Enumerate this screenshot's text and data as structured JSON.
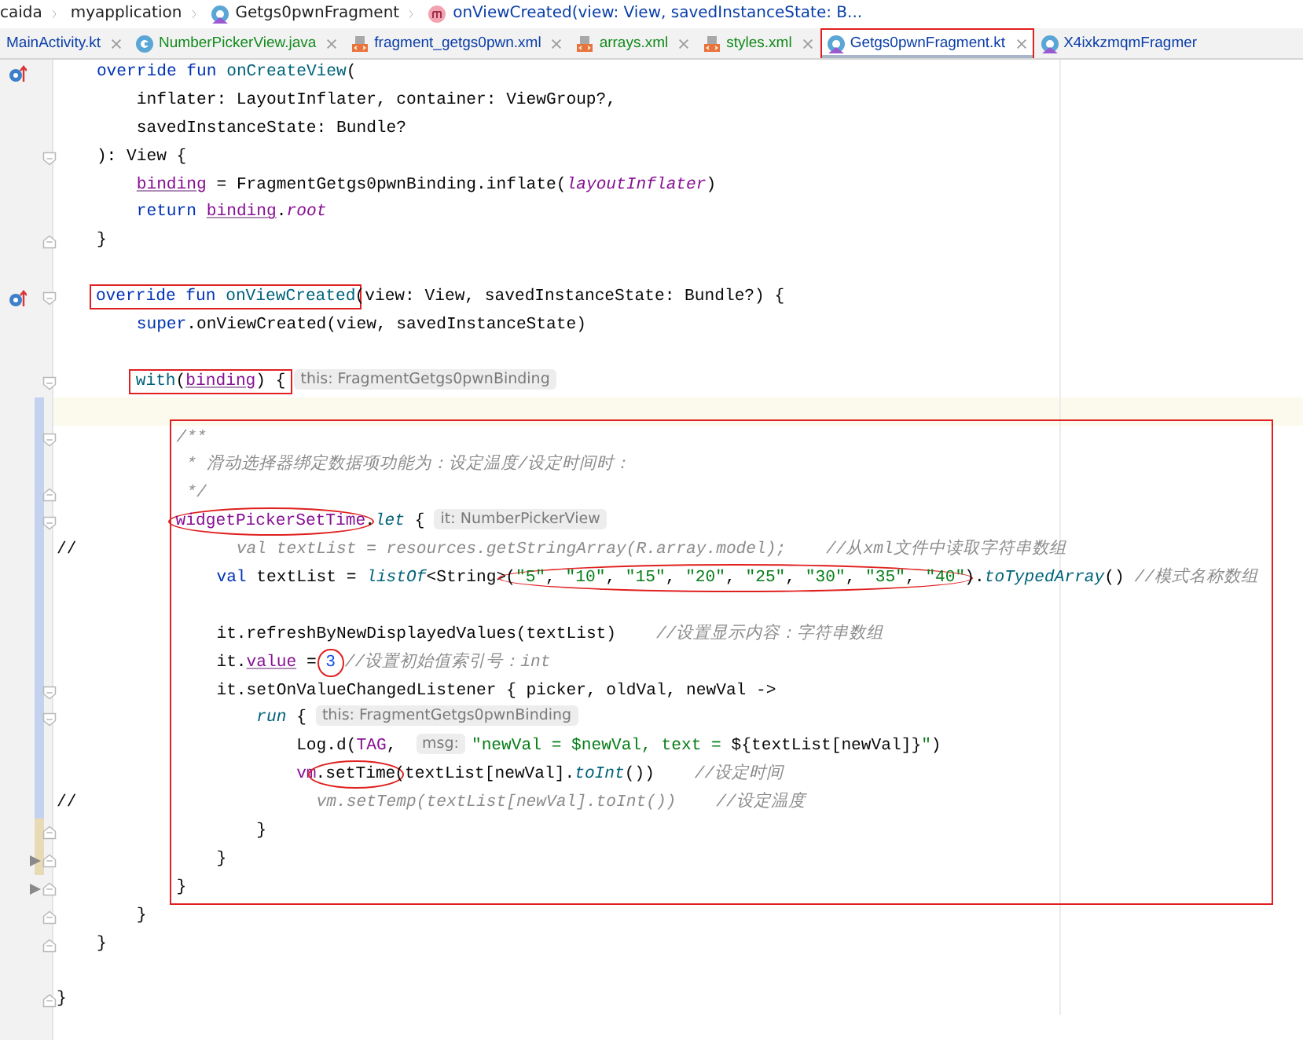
{
  "breadcrumbs": [
    {
      "label": "caida",
      "kind": "folder"
    },
    {
      "label": "myapplication",
      "kind": "folder"
    },
    {
      "label": "Getgs0pwnFragment",
      "kind": "kotlin"
    },
    {
      "label": "onViewCreated(view: View, savedInstanceState: B...",
      "kind": "method"
    }
  ],
  "tabs": [
    {
      "label": "MainActivity.kt",
      "kind": "cut",
      "color": "#0a3ea8",
      "selected": false,
      "closable": true,
      "annotated": false
    },
    {
      "label": "NumberPickerView.java",
      "kind": "java",
      "color": "#138a1c",
      "selected": false,
      "closable": true,
      "annotated": false
    },
    {
      "label": "fragment_getgs0pwn.xml",
      "kind": "xml",
      "color": "#0a3ea8",
      "selected": false,
      "closable": true,
      "annotated": false
    },
    {
      "label": "arrays.xml",
      "kind": "xml",
      "color": "#138a1c",
      "selected": false,
      "closable": true,
      "annotated": false
    },
    {
      "label": "styles.xml",
      "kind": "xml",
      "color": "#138a1c",
      "selected": false,
      "closable": true,
      "annotated": false
    },
    {
      "label": "Getgs0pwnFragment.kt",
      "kind": "kotlin",
      "color": "#0a3ea8",
      "selected": true,
      "closable": true,
      "annotated": true
    },
    {
      "label": "X4ixkzmqmFragmer",
      "kind": "kotlin",
      "color": "#0a3ea8",
      "selected": false,
      "closable": false,
      "annotated": false
    }
  ],
  "code": [
    {
      "kind": "line",
      "override_marker": true,
      "tokens": [
        {
          "kind": "kw",
          "text": "    override fun "
        },
        {
          "kind": "decl",
          "text": "onCreateView"
        },
        {
          "kind": "plain",
          "text": "("
        }
      ]
    },
    {
      "kind": "line",
      "tokens": [
        {
          "kind": "plain",
          "text": "        inflater: LayoutInflater, container: ViewGroup?,"
        }
      ]
    },
    {
      "kind": "line",
      "tokens": [
        {
          "kind": "plain",
          "text": "        savedInstanceState: Bundle?"
        }
      ]
    },
    {
      "kind": "line",
      "fold_start": true,
      "tokens": [
        {
          "kind": "plain",
          "text": "    ): View {"
        }
      ]
    },
    {
      "kind": "line",
      "tokens": [
        {
          "kind": "prop_u",
          "text": "        binding"
        },
        {
          "kind": "plain",
          "text": " = FragmentGetgs0pwnBinding.inflate("
        },
        {
          "kind": "prop_i",
          "text": "layoutInflater"
        },
        {
          "kind": "plain",
          "text": ")"
        }
      ]
    },
    {
      "kind": "line",
      "tokens": [
        {
          "kind": "kw",
          "text": "        return "
        },
        {
          "kind": "prop_u",
          "text": "binding"
        },
        {
          "kind": "plain",
          "text": "."
        },
        {
          "kind": "prop_i",
          "text": "root"
        }
      ]
    },
    {
      "kind": "line",
      "fold_end": true,
      "tokens": [
        {
          "kind": "plain",
          "text": "    }"
        }
      ]
    },
    {
      "kind": "line"
    },
    {
      "kind": "line",
      "override_marker": true,
      "fold_start": true,
      "tokens": [
        {
          "kind": "boxed",
          "tokens": [
            {
              "kind": "kw",
              "text": "    override fun "
            },
            {
              "kind": "decl",
              "text": "onViewCreated"
            }
          ]
        },
        {
          "kind": "plain",
          "text": "(view: View, savedInstanceState: Bundle?) {"
        }
      ]
    },
    {
      "kind": "line",
      "tokens": [
        {
          "kind": "kw",
          "text": "        super"
        },
        {
          "kind": "plain",
          "text": ".onViewCreated(view, savedInstanceState)"
        }
      ]
    },
    {
      "kind": "line"
    },
    {
      "kind": "line",
      "fold_start": true,
      "tokens": [
        {
          "kind": "boxed",
          "tokens": [
            {
              "kind": "decl",
              "text": "        with"
            },
            {
              "kind": "plain",
              "text": "("
            },
            {
              "kind": "prop_u",
              "text": "binding"
            },
            {
              "kind": "plain",
              "text": ") {"
            }
          ]
        },
        {
          "kind": "hint",
          "text": "this: FragmentGetgs0pwnBinding"
        }
      ]
    },
    {
      "kind": "line",
      "current": true,
      "color": "#c3d3ef"
    },
    {
      "kind": "boxed-block",
      "lines": [
        {
          "kind": "line",
          "fold_start": true,
          "color": "#c3d3ef",
          "tokens": [
            {
              "kind": "doc",
              "text": "            /**"
            }
          ]
        },
        {
          "kind": "line",
          "color": "#c3d3ef",
          "tokens": [
            {
              "kind": "doc",
              "text": "             * 滑动选择器绑定数据项功能为：设定温度/设定时间时："
            }
          ]
        },
        {
          "kind": "line",
          "fold_end": true,
          "color": "#c3d3ef",
          "tokens": [
            {
              "kind": "doc",
              "text": "             */"
            }
          ]
        },
        {
          "kind": "line",
          "fold_start": true,
          "color": "#c3d3ef",
          "tokens": [
            {
              "kind": "circled",
              "tokens": [
                {
                  "kind": "prop",
                  "text": "            widgetPickerSetTime"
                }
              ]
            },
            {
              "kind": "plain",
              "text": "."
            },
            {
              "kind": "ext",
              "text": "let"
            },
            {
              "kind": "plain",
              "text": " {"
            },
            {
              "kind": "hint",
              "text": "it: NumberPickerView"
            }
          ]
        },
        {
          "kind": "line",
          "color": "#c3d3ef",
          "tokens": [
            {
              "kind": "plain",
              "text": "//"
            },
            {
              "kind": "doc",
              "text": "                val textList = resources.getStringArray(R.array.model);    //从xml文件中读取字符串数组"
            }
          ]
        },
        {
          "kind": "line",
          "color": "#c3d3ef",
          "tokens": [
            {
              "kind": "kw",
              "text": "                val "
            },
            {
              "kind": "plain",
              "text": "textList = "
            },
            {
              "kind": "ext",
              "text": "listOf"
            },
            {
              "kind": "plain",
              "text": "<String>"
            },
            {
              "kind": "circled",
              "tokens": [
                {
                  "kind": "plain",
                  "text": "("
                },
                {
                  "kind": "str",
                  "text": "\"5\""
                },
                {
                  "kind": "plain",
                  "text": ", "
                },
                {
                  "kind": "str",
                  "text": "\"10\""
                },
                {
                  "kind": "plain",
                  "text": ", "
                },
                {
                  "kind": "str",
                  "text": "\"15\""
                },
                {
                  "kind": "plain",
                  "text": ", "
                },
                {
                  "kind": "str",
                  "text": "\"20\""
                },
                {
                  "kind": "plain",
                  "text": ", "
                },
                {
                  "kind": "str",
                  "text": "\"25\""
                },
                {
                  "kind": "plain",
                  "text": ", "
                },
                {
                  "kind": "str",
                  "text": "\"30\""
                },
                {
                  "kind": "plain",
                  "text": ", "
                },
                {
                  "kind": "str",
                  "text": "\"35\""
                },
                {
                  "kind": "plain",
                  "text": ", "
                },
                {
                  "kind": "str",
                  "text": "\"40\""
                }
              ]
            },
            {
              "kind": "plain",
              "text": ")."
            },
            {
              "kind": "ext",
              "text": "toTypedArray"
            },
            {
              "kind": "plain",
              "text": "() "
            },
            {
              "kind": "comment",
              "text": "//模式名称数组"
            }
          ]
        },
        {
          "kind": "line",
          "color": "#c3d3ef"
        },
        {
          "kind": "line",
          "color": "#c3d3ef",
          "tokens": [
            {
              "kind": "plain",
              "text": "                it.refreshByNewDisplayedValues(textList)    "
            },
            {
              "kind": "comment",
              "text": "//设置显示内容：字符串数组"
            }
          ]
        },
        {
          "kind": "line",
          "color": "#c3d3ef",
          "tokens": [
            {
              "kind": "plain",
              "text": "                it."
            },
            {
              "kind": "prop_u",
              "text": "value"
            },
            {
              "kind": "plain",
              "text": " = "
            },
            {
              "kind": "circled",
              "tokens": [
                {
                  "kind": "num",
                  "text": "3"
                }
              ]
            },
            {
              "kind": "comment",
              "text": " //设置初始值索引号：int"
            }
          ]
        },
        {
          "kind": "line",
          "fold_start": true,
          "color": "#c3d3ef",
          "tokens": [
            {
              "kind": "plain",
              "text": "                it.setOnValueChangedListener { picker, oldVal, newVal ->"
            }
          ]
        },
        {
          "kind": "line",
          "fold_start": true,
          "color": "#c3d3ef",
          "tokens": [
            {
              "kind": "ext",
              "text": "                    run"
            },
            {
              "kind": "plain",
              "text": " {"
            },
            {
              "kind": "hint",
              "text": "this: FragmentGetgs0pwnBinding"
            }
          ]
        },
        {
          "kind": "line",
          "color": "#c3d3ef",
          "tokens": [
            {
              "kind": "plain",
              "text": "                        Log.d("
            },
            {
              "kind": "prop",
              "text": "TAG"
            },
            {
              "kind": "plain",
              "text": ", "
            },
            {
              "kind": "hint",
              "text": "msg:"
            },
            {
              "kind": "str",
              "text": "\"newVal = $newVal, text = "
            },
            {
              "kind": "plain",
              "text": "${textList[newVal]}"
            },
            {
              "kind": "str",
              "text": "\""
            },
            {
              "kind": "plain",
              "text": ")"
            }
          ]
        },
        {
          "kind": "line",
          "color": "#c3d3ef",
          "tokens": [
            {
              "kind": "prop",
              "text": "                        vm"
            },
            {
              "kind": "circled",
              "tokens": [
                {
                  "kind": "plain",
                  "text": ".setTime"
                }
              ]
            },
            {
              "kind": "plain",
              "text": "(textList[newVal]."
            },
            {
              "kind": "ext",
              "text": "toInt"
            },
            {
              "kind": "plain",
              "text": "())    "
            },
            {
              "kind": "comment",
              "text": "//设定时间"
            }
          ]
        },
        {
          "kind": "line",
          "color": "#c3d3ef",
          "tokens": [
            {
              "kind": "plain",
              "text": "//"
            },
            {
              "kind": "doc",
              "text": "                        vm.setTemp(textList[newVal].toInt())    //设定温度"
            }
          ]
        },
        {
          "kind": "line",
          "fold_end": true,
          "color": "#e8dab4",
          "tokens": [
            {
              "kind": "plain",
              "text": "                    }"
            }
          ]
        },
        {
          "kind": "line",
          "fold_end": true,
          "color": "#e8dab4",
          "pointer": true,
          "tokens": [
            {
              "kind": "plain",
              "text": "                }"
            }
          ]
        },
        {
          "kind": "line",
          "fold_end": true,
          "pointer": true,
          "tokens": [
            {
              "kind": "plain",
              "text": "            }"
            }
          ]
        }
      ]
    },
    {
      "kind": "line",
      "fold_end": true,
      "tokens": [
        {
          "kind": "plain",
          "text": "        }"
        }
      ]
    },
    {
      "kind": "line",
      "fold_end": true,
      "tokens": [
        {
          "kind": "plain",
          "text": "    }"
        }
      ]
    },
    {
      "kind": "line"
    },
    {
      "kind": "line",
      "fold_end": true,
      "tokens": [
        {
          "kind": "plain",
          "text": "}"
        }
      ]
    }
  ]
}
